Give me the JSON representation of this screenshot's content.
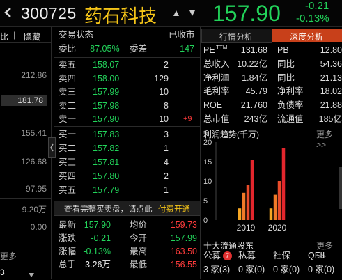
{
  "header": {
    "code": "300725",
    "name": "药石科技",
    "price": "157.90",
    "change": "-0.21",
    "change_pct": "-0.13%"
  },
  "left_panel": {
    "tab1": "比",
    "tab2": "隐藏",
    "prices": [
      "212.86",
      "181.78",
      "155.41",
      "126.68",
      "97.95"
    ],
    "volume_max": "9.20万",
    "volume_min": "0.00",
    "more": "更多",
    "count": "3",
    "colors": {
      "up": "#ff3b3b",
      "down": "#22d35a"
    }
  },
  "order_book": {
    "title": "交易状态",
    "status": "已收市",
    "ratio_label": "委比",
    "ratio_value": "-87.05%",
    "diff_label": "委差",
    "diff_value": "-147",
    "asks": [
      {
        "label": "卖五",
        "price": "158.07",
        "vol": "2",
        "delta": ""
      },
      {
        "label": "卖四",
        "price": "158.00",
        "vol": "129",
        "delta": ""
      },
      {
        "label": "卖三",
        "price": "157.99",
        "vol": "10",
        "delta": ""
      },
      {
        "label": "卖二",
        "price": "157.98",
        "vol": "8",
        "delta": ""
      },
      {
        "label": "卖一",
        "price": "157.90",
        "vol": "10",
        "delta": "+9"
      }
    ],
    "bids": [
      {
        "label": "买一",
        "price": "157.83",
        "vol": "3"
      },
      {
        "label": "买二",
        "price": "157.82",
        "vol": "1"
      },
      {
        "label": "买三",
        "price": "157.81",
        "vol": "4"
      },
      {
        "label": "买四",
        "price": "157.80",
        "vol": "2"
      },
      {
        "label": "买五",
        "price": "157.79",
        "vol": "1"
      }
    ],
    "banner_text": "查看完整买卖盘，请点此",
    "banner_link": "付费开通"
  },
  "quote": {
    "rows": [
      {
        "l1": "最新",
        "v1": "157.90",
        "l2": "均价",
        "v2": "159.73"
      },
      {
        "l1": "涨跌",
        "v1": "-0.21",
        "l2": "今开",
        "v2": "157.99"
      },
      {
        "l1": "涨幅",
        "v1": "-0.13%",
        "l2": "最高",
        "v2": "163.50"
      },
      {
        "l1": "总手",
        "v1": "3.26万",
        "l2": "最低",
        "v2": "156.55"
      }
    ]
  },
  "right_panel": {
    "tab_industry": "行情分析",
    "tab_depth": "深度分析",
    "fundamentals": [
      {
        "l1": "PE",
        "sup": "TTM",
        "v1": "131.68",
        "l2": "PB",
        "v2": "12.80"
      },
      {
        "l1": "总收入",
        "sup": "",
        "v1": "10.22亿",
        "l2": "同比",
        "v2": "54.36"
      },
      {
        "l1": "净利润",
        "sup": "",
        "v1": "1.84亿",
        "l2": "同比",
        "v2": "21.13"
      },
      {
        "l1": "毛利率",
        "sup": "",
        "v1": "45.79",
        "l2": "净利率",
        "v2": "18.02"
      },
      {
        "l1": "ROE",
        "sup": "",
        "v1": "21.760",
        "l2": "负债率",
        "v2": "21.88"
      },
      {
        "l1": "总市值",
        "sup": "",
        "v1": "243亿",
        "l2": "流通值",
        "v2": "185亿"
      }
    ],
    "profit_title": "利润趋势(千万)",
    "more": "更多>>",
    "holders_title": "十大流通股东",
    "holders_more": "更多>>",
    "holder_cols": [
      {
        "label": "公募",
        "badge": "7",
        "value": "3 家(3)"
      },
      {
        "label": "私募",
        "badge": "",
        "value": "0 家(0)"
      },
      {
        "label": "社保",
        "badge": "",
        "value": "0 家(0)"
      },
      {
        "label": "QFII",
        "badge": "",
        "value": "0 家(0)"
      }
    ]
  },
  "chart_data": {
    "type": "bar",
    "title": "利润趋势(千万)",
    "ylim": [
      0,
      20
    ],
    "yticks": [
      "20",
      "15",
      "10",
      "5",
      "0"
    ],
    "categories": [
      "2019",
      "2020"
    ],
    "series_values": {
      "2019": [
        3,
        7,
        9,
        15.5
      ],
      "2020": [
        3,
        6.5,
        10,
        18.5
      ]
    },
    "colors": [
      "#f5a623",
      "#f07a28",
      "#ea4c2a",
      "#e3262d"
    ]
  }
}
